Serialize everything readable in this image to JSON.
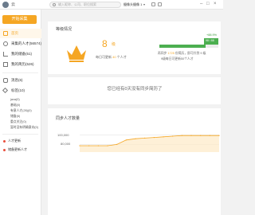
{
  "topbar": {
    "user_name": "云",
    "search_placeholder": "输入昵称、公司、职位搜索",
    "camera_name": "摄像头摄像 1"
  },
  "sidebar": {
    "collect_button": "开始采集",
    "items": [
      {
        "label": "首页",
        "icon": "home-icon",
        "active": true
      },
      {
        "label": "采集的人才(56574)",
        "icon": "user-icon"
      },
      {
        "label": "我的储备(51)",
        "icon": "chart-icon"
      },
      {
        "label": "我的简历(526)",
        "icon": "doc-icon"
      },
      {
        "label": "消息(6)",
        "icon": "chat-icon"
      },
      {
        "label": "标签(10)",
        "icon": "tag-icon"
      }
    ],
    "tags": [
      "java(0)",
      "基础(0)",
      "有意人才(26)(0)",
      "储备(6)",
      "重点关注(0)",
      "暂时没有明确意向(0)"
    ],
    "dot_items": [
      "人才更新",
      "储备更新人才"
    ]
  },
  "main": {
    "card_title": "等级情况",
    "vip_number": "8",
    "vip_unit": "级",
    "vip_label_prefix": "每日可更新",
    "vip_label_count": "40",
    "vip_label_suffix": "个人才",
    "bar_top_label": "+88.9%",
    "bar_tip": "98 / 88",
    "bar_text_prefix": "再同步",
    "bar_text_count": "1725",
    "bar_text_suffix": "份简历，即可升到 9 级",
    "bar_text_2": "9级每日可更新50个人才",
    "sync_message": "您已经有0天没有同步简历了",
    "chart_title": "同步人才数量"
  },
  "chart_data": {
    "type": "area",
    "title": "同步人才数量",
    "xlabel": "",
    "ylabel": "",
    "y_ticks": [
      "100,000",
      "80,000"
    ],
    "ylim": [
      70000,
      110000
    ],
    "series": [
      {
        "values": [
          80000,
          80000,
          80000,
          80000,
          82000,
          89000,
          91000,
          92000,
          93000,
          94000,
          95000,
          96000,
          96000,
          96000,
          96000,
          96000
        ]
      }
    ],
    "color": "#f5a623",
    "grid": true
  }
}
